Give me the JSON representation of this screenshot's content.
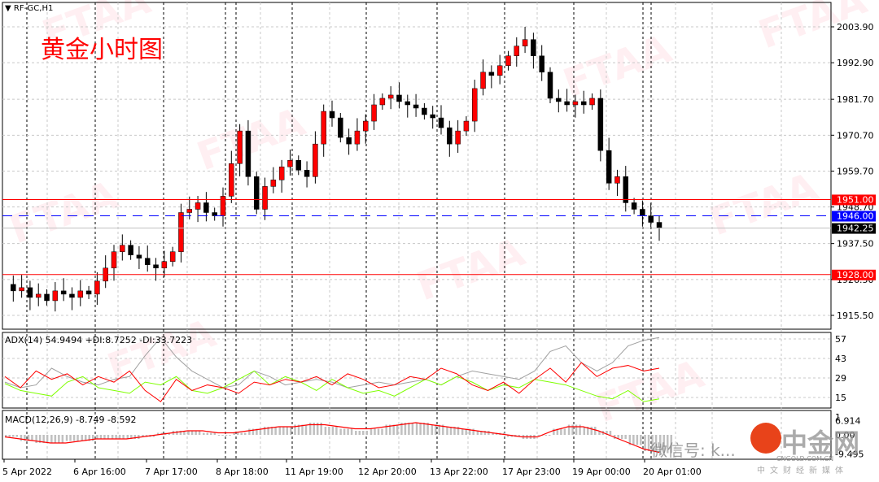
{
  "header": {
    "symbol": "RF-GC,H1",
    "title": "黄金小时图"
  },
  "watermark": "FTAA",
  "logo": {
    "name": "中金网",
    "sub": "CNGOLD.COM.CN",
    "tag": "中文财经新媒体",
    "wechat": "微信号: k..."
  },
  "colors": {
    "bull": "#ff0000",
    "bear": "#000000",
    "resistance": "#ff0000",
    "blue_line": "#0000ff",
    "adx_plus": "#7fff00",
    "adx_minus": "#ff0000",
    "adx": "#a0a0a0"
  },
  "chart_data": [
    {
      "type": "candlestick",
      "title": "黄金小时图",
      "ylim": [
        1910,
        2008
      ],
      "y_ticks": [
        "2003.90",
        "1992.90",
        "1981.70",
        "1970.70",
        "1959.70",
        "1948.70",
        "1937.50",
        "1926.50",
        "1915.50"
      ],
      "x_ticks": [
        "5 Apr 2022",
        "6 Apr 16:00",
        "7 Apr 17:00",
        "8 Apr 18:00",
        "11 Apr 19:00",
        "12 Apr 20:00",
        "13 Apr 22:00",
        "17 Apr 23:00",
        "19 Apr 00:00",
        "20 Apr 01:00"
      ],
      "closes": [
        1925,
        1923,
        1924,
        1921,
        1922,
        1920,
        1923,
        1922,
        1921,
        1923,
        1922,
        1926,
        1930,
        1935,
        1937,
        1934,
        1933,
        1931,
        1930,
        1932,
        1935,
        1947,
        1948,
        1950,
        1947,
        1946,
        1952,
        1962,
        1972,
        1958,
        1948,
        1955,
        1957,
        1961,
        1963,
        1960,
        1958,
        1968,
        1978,
        1976,
        1970,
        1968,
        1972,
        1975,
        1980,
        1982,
        1983,
        1981,
        1980,
        1979,
        1977,
        1976,
        1973,
        1968,
        1972,
        1975,
        1985,
        1990,
        1989,
        1992,
        1995,
        1998,
        2000,
        1995,
        1990,
        1982,
        1981,
        1980,
        1981,
        1980,
        1982,
        1966,
        1956,
        1958,
        1950,
        1948,
        1946,
        1944,
        1942.25
      ],
      "levels": [
        {
          "label": "1951.00",
          "value": 1951.0,
          "style": "resistance"
        },
        {
          "label": "1946.00",
          "value": 1946.0,
          "style": "blue-dashed"
        },
        {
          "label": "1942.25",
          "value": 1942.25,
          "style": "current"
        },
        {
          "label": "1928.00",
          "value": 1928.0,
          "style": "support"
        }
      ]
    },
    {
      "type": "line",
      "title": "ADX(14) 54.9494 +DI:8.7252 -DI:33.7223",
      "ylim": [
        0,
        62
      ],
      "y_ticks": [
        "57",
        "43",
        "29",
        "15",
        "1"
      ],
      "series": [
        {
          "name": "ADX",
          "values": [
            26,
            22,
            24,
            36,
            30,
            26,
            24,
            28,
            30,
            45,
            58,
            44,
            34,
            28,
            22,
            24,
            34,
            30,
            24,
            26,
            28,
            26,
            22,
            24,
            26,
            24,
            26,
            28,
            24,
            30,
            34,
            32,
            30,
            28,
            34,
            48,
            52,
            40,
            34,
            40,
            52,
            56,
            58
          ]
        },
        {
          "name": "+DI",
          "values": [
            25,
            20,
            18,
            16,
            26,
            30,
            22,
            20,
            18,
            26,
            24,
            30,
            20,
            18,
            22,
            28,
            34,
            24,
            30,
            26,
            20,
            28,
            22,
            18,
            20,
            16,
            22,
            28,
            24,
            30,
            26,
            20,
            24,
            22,
            28,
            26,
            24,
            20,
            16,
            14,
            20,
            12,
            14
          ]
        },
        {
          "name": "-DI",
          "values": [
            30,
            22,
            34,
            28,
            32,
            24,
            30,
            26,
            34,
            20,
            12,
            28,
            20,
            24,
            22,
            18,
            26,
            24,
            28,
            26,
            30,
            24,
            32,
            28,
            22,
            24,
            30,
            28,
            36,
            32,
            24,
            20,
            26,
            18,
            28,
            36,
            26,
            40,
            30,
            36,
            38,
            34,
            36
          ]
        }
      ]
    },
    {
      "type": "bar+line",
      "title": "MACD(12,26,9) -8.749 -8.592",
      "ylim": [
        -12,
        9
      ],
      "y_ticks": [
        "6.914",
        "0.00",
        "-9.495"
      ],
      "histogram": [
        -1,
        -3,
        -4,
        -4,
        -3,
        -3,
        -2,
        -2,
        -2,
        -1,
        1,
        2,
        2,
        1,
        0,
        1,
        3,
        4,
        4,
        5,
        6,
        4,
        3,
        2,
        3,
        5,
        6,
        6,
        5,
        4,
        3,
        2,
        1,
        -1,
        -2,
        0,
        3,
        5,
        4,
        2,
        -2,
        -5,
        -8,
        -9
      ],
      "signal": [
        -1,
        -2,
        -3,
        -4,
        -4,
        -3,
        -2,
        -2,
        -2,
        -1,
        0,
        1,
        2,
        2,
        1,
        1,
        2,
        3,
        4,
        4,
        5,
        5,
        4,
        3,
        3,
        4,
        5,
        6,
        5,
        4,
        3,
        2,
        1,
        0,
        -1,
        -1,
        2,
        4,
        4,
        2,
        -1,
        -4,
        -7,
        -8.6
      ]
    }
  ]
}
